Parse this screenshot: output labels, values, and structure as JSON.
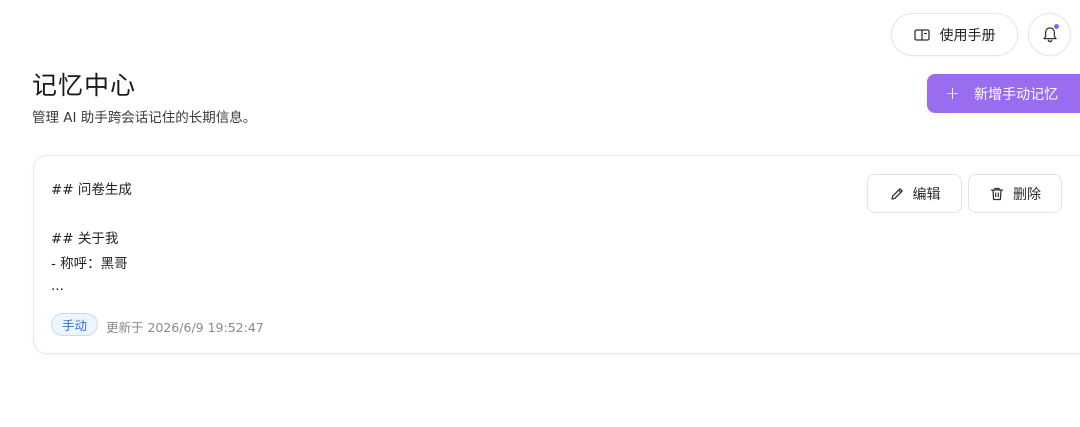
{
  "toolbar": {
    "manual_label": "使用手册",
    "manual_icon": "book-icon",
    "bell_icon": "bell-icon",
    "notification_dot_color": "#8f63e8"
  },
  "header": {
    "title": "记忆中心",
    "subtitle": "管理 AI 助手跨会话记住的长期信息。",
    "add_button_label": "新增手动记忆",
    "add_button_icon": "plus-icon",
    "accent_color": "#9a6df0"
  },
  "memories": [
    {
      "lines": [
        "## 问卷生成",
        "## 关于我",
        "- 称呼：黑哥",
        "..."
      ],
      "edit_label": "编辑",
      "delete_label": "删除",
      "tag": "手动",
      "updated": "更新于 2026/6/9 19:52:47"
    }
  ]
}
